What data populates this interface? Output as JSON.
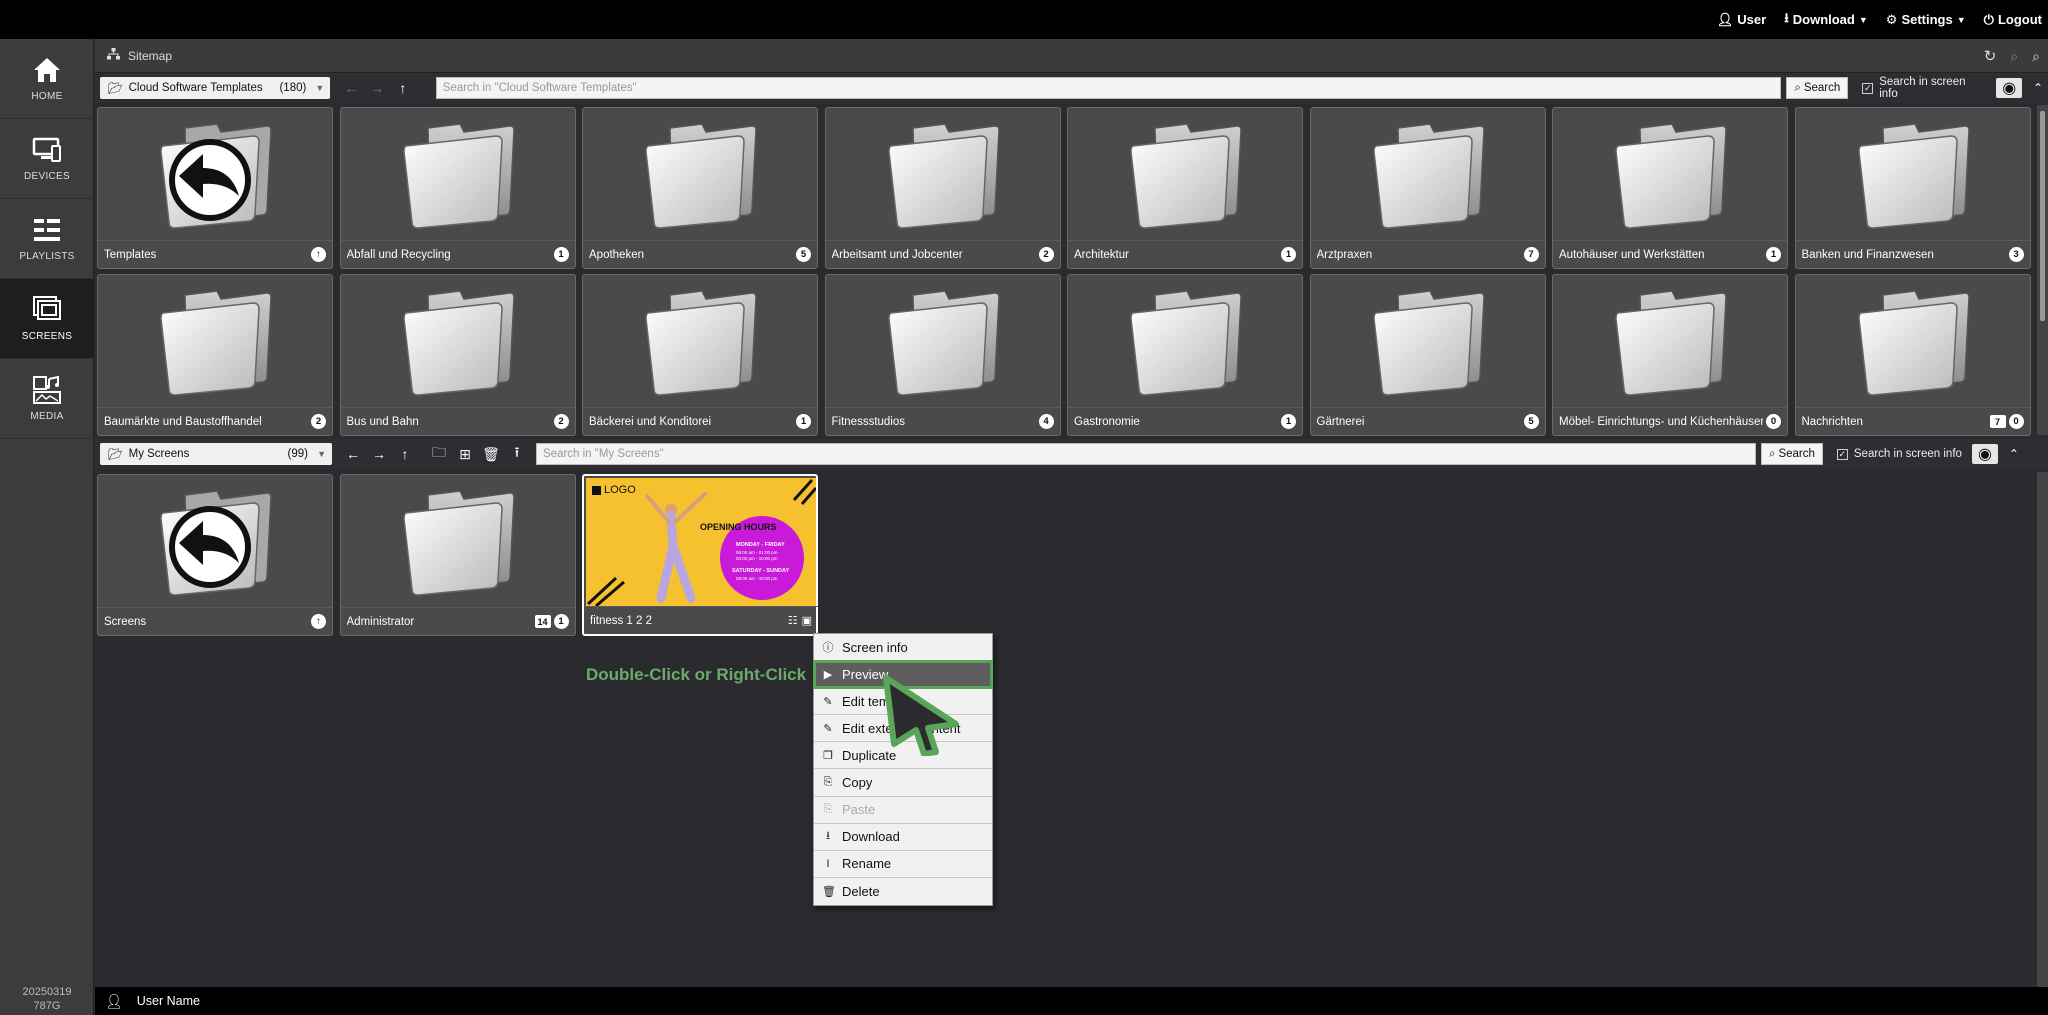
{
  "topnav": {
    "user": "User",
    "download": "Download",
    "settings": "Settings",
    "logout": "Logout"
  },
  "sidebar": {
    "items": [
      {
        "label": "HOME",
        "icon": "home-icon"
      },
      {
        "label": "DEVICES",
        "icon": "devices-icon"
      },
      {
        "label": "PLAYLISTS",
        "icon": "playlists-icon"
      },
      {
        "label": "SCREENS",
        "icon": "screens-icon",
        "active": true
      },
      {
        "label": "MEDIA",
        "icon": "media-icon"
      }
    ],
    "version": "20250319",
    "build": "787G"
  },
  "sitemap": {
    "label": "Sitemap"
  },
  "cloud": {
    "folder": "Cloud Software Templates",
    "count": "(180)",
    "search_placeholder": "Search in \"Cloud Software Templates\"",
    "search_label": "Search",
    "search_info_label": "Search in screen info",
    "tiles": [
      {
        "label": "Templates",
        "type": "back"
      },
      {
        "label": "Abfall und Recycling",
        "badge": "1"
      },
      {
        "label": "Apotheken",
        "badge": "5"
      },
      {
        "label": "Arbeitsamt und Jobcenter",
        "badge": "2"
      },
      {
        "label": "Architektur",
        "badge": "1"
      },
      {
        "label": "Arztpraxen",
        "badge": "7"
      },
      {
        "label": "Autohäuser und Werkstätten",
        "badge": "1"
      },
      {
        "label": "Banken und Finanzwesen",
        "badge": "3"
      },
      {
        "label": "Baumärkte und Baustoffhandel",
        "badge": "2"
      },
      {
        "label": "Bus und Bahn",
        "badge": "2"
      },
      {
        "label": "Bäckerei und Konditorei",
        "badge": "1"
      },
      {
        "label": "Fitnessstudios",
        "badge": "4"
      },
      {
        "label": "Gastronomie",
        "badge": "1"
      },
      {
        "label": "Gärtnerei",
        "badge": "5"
      },
      {
        "label": "Möbel- Einrichtungs- und Küchenhäuser",
        "badge": "0"
      },
      {
        "label": "Nachrichten",
        "badge": "0",
        "sqbadge": "7"
      }
    ]
  },
  "my": {
    "folder": "My Screens",
    "count": "(99)",
    "search_placeholder": "Search in \"My Screens\"",
    "search_label": "Search",
    "search_info_label": "Search in screen info",
    "tiles": [
      {
        "label": "Screens",
        "type": "back"
      },
      {
        "label": "Administrator",
        "badge": "1",
        "sqbadge": "14"
      },
      {
        "label": "fitness 1 2 2",
        "type": "screen"
      }
    ]
  },
  "thumbnail": {
    "logo": "LOGO",
    "heading": "OPENING HOURS",
    "weekday_title": "MONDAY - FRIDAY",
    "weekday_hours_1": "06:00 am - 01:00 pm",
    "weekday_hours_2": "03:00 pm - 10:00 pm",
    "weekend_title": "SATURDAY - SUNDAY",
    "weekend_hours": "08:00 am - 18:00 pm"
  },
  "hint": "Double-Click or Right-Click",
  "context_menu": [
    {
      "label": "Screen info",
      "icon": "info-icon"
    },
    {
      "label": "Preview",
      "icon": "play-icon",
      "highlighted": true
    },
    {
      "label": "Edit template",
      "icon": "edit-icon"
    },
    {
      "label": "Edit external content",
      "icon": "edit-icon"
    },
    {
      "label": "Duplicate",
      "icon": "duplicate-icon"
    },
    {
      "label": "Copy",
      "icon": "copy-icon"
    },
    {
      "label": "Paste",
      "icon": "paste-icon",
      "disabled": true
    },
    {
      "label": "Download",
      "icon": "download-icon"
    },
    {
      "label": "Rename",
      "icon": "text-cursor-icon"
    },
    {
      "label": "Delete",
      "icon": "trash-icon"
    }
  ],
  "status": {
    "user_name": "User Name"
  },
  "colors": {
    "highlight": "#5aa55a",
    "thumbnail_bg": "#f5c12e",
    "circle": "#c81ad8"
  }
}
